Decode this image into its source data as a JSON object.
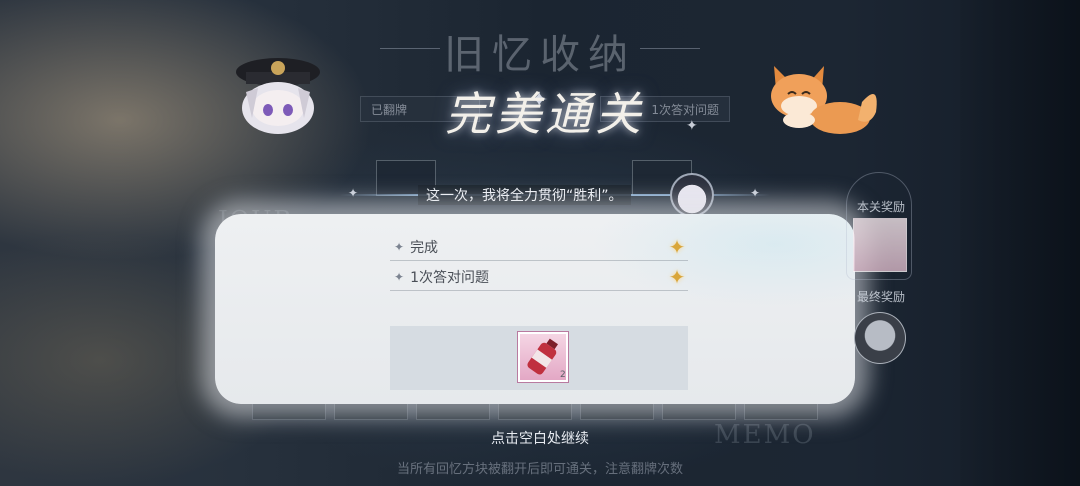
{
  "background": {
    "title": "旧忆收纳",
    "deco_word_left": "JOUR",
    "deco_word_right": "MEMO",
    "stat_left": "已翻牌",
    "stat_right": "1次答对问题"
  },
  "result": {
    "banner": "完美通关",
    "quote": "这一次，我将全力贯彻“胜利”。"
  },
  "objectives": [
    {
      "label": "完成",
      "achieved": true
    },
    {
      "label": "1次答对问题",
      "achieved": true
    }
  ],
  "reward": {
    "item_icon": "drink-bottle-icon",
    "count": "2"
  },
  "sidebar": {
    "stage_reward_label": "本关奖励",
    "final_reward_label": "最终奖励"
  },
  "footer": {
    "continue_text": "点击空白处继续",
    "hint_text": "当所有回忆方块被翻开后即可通关，注意翻牌次数"
  },
  "colors": {
    "star": "#d9a63a",
    "panel": "#eef0f2",
    "reward_bg": "#d6dce2",
    "item_pink": "#e3a8c5"
  }
}
